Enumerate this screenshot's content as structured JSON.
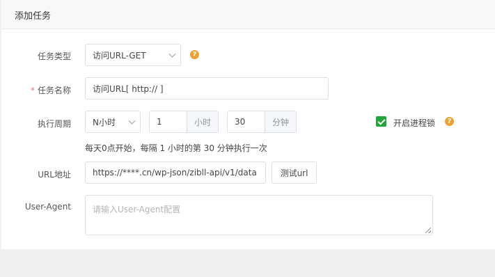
{
  "header": {
    "title": "添加任务"
  },
  "form": {
    "task_type": {
      "label": "任务类型",
      "value": "访问URL-GET"
    },
    "task_name": {
      "required_mark": "*",
      "label": "任务名称",
      "value": "访问URL[ http:// ]"
    },
    "cycle": {
      "label": "执行周期",
      "mode": "N小时",
      "hours_value": "1",
      "hours_unit": "小时",
      "minutes_value": "30",
      "minutes_unit": "分钟",
      "process_lock_label": "开启进程锁",
      "process_lock_checked": true,
      "hint": "每天0点开始，每隔 1 小时的第 30 分钟执行一次"
    },
    "url": {
      "label": "URL地址",
      "value": "https://****.cn/wp-json/zibll-api/v1/data",
      "test_button": "测试url"
    },
    "user_agent": {
      "label": "User-Agent",
      "placeholder": "请输入User-Agent配置"
    }
  },
  "icons": {
    "help": "help-icon",
    "help_glyph": "?"
  },
  "colors": {
    "checkbox_accent": "#20a53a",
    "help_accent": "#f0a030",
    "required": "#f56c6c"
  }
}
